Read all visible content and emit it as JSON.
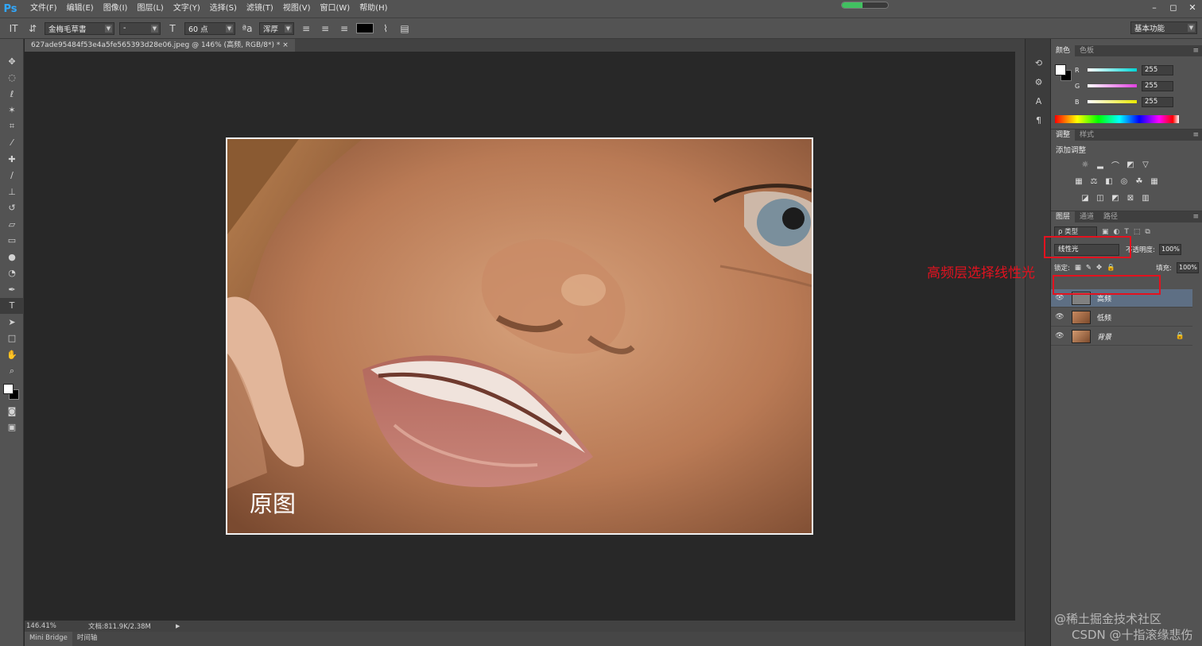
{
  "app": {
    "logo": "Ps",
    "menu": [
      "文件(F)",
      "编辑(E)",
      "图像(I)",
      "图层(L)",
      "文字(Y)",
      "选择(S)",
      "滤镜(T)",
      "视图(V)",
      "窗口(W)",
      "帮助(H)"
    ],
    "progress_fraction": 0.45,
    "window_buttons": [
      "–",
      "◻",
      "✕"
    ]
  },
  "options_bar": {
    "font_family": "金梅毛草書",
    "font_style": "-",
    "font_size": "60 点",
    "antialias": "浑厚",
    "workspace": "基本功能"
  },
  "document": {
    "tab_title": "627ade95484f53e4a5fe565393d28e06.jpeg @ 146% (高频, RGB/8*) *",
    "tab_close": "×",
    "photo_caption": "原图"
  },
  "status": {
    "zoom": "146.41%",
    "doc_size": "文档:811.9K/2.38M",
    "play": "▶"
  },
  "bottom_tabs": [
    "Mini Bridge",
    "时间轴"
  ],
  "color_panel": {
    "tabs": [
      "颜色",
      "色板"
    ],
    "channels": [
      {
        "label": "R",
        "value": "255",
        "gradient": "#00d5d5"
      },
      {
        "label": "G",
        "value": "255",
        "gradient": "#e040e0"
      },
      {
        "label": "B",
        "value": "255",
        "gradient": "#e8e800"
      }
    ]
  },
  "adjustments_panel": {
    "tabs": [
      "调整",
      "样式"
    ],
    "title": "添加调整"
  },
  "layers_panel": {
    "tabs": [
      "图层",
      "通道",
      "路径"
    ],
    "filter_kind": "ρ 类型",
    "blend_mode": "线性光",
    "opacity_label": "不透明度:",
    "opacity_value": "100%",
    "lock_label": "锁定:",
    "fill_label": "填充:",
    "fill_value": "100%",
    "layers": [
      {
        "name": "高频",
        "selected": true,
        "thumb": "gray"
      },
      {
        "name": "低频",
        "selected": false,
        "thumb": "face"
      },
      {
        "name": "背景",
        "selected": false,
        "thumb": "face",
        "locked": true
      }
    ]
  },
  "annotation": {
    "text": "高频层选择线性光",
    "color": "#e3121f"
  },
  "watermarks": [
    "@稀土掘金技术社区",
    "CSDN @十指滚缘悲伤"
  ]
}
